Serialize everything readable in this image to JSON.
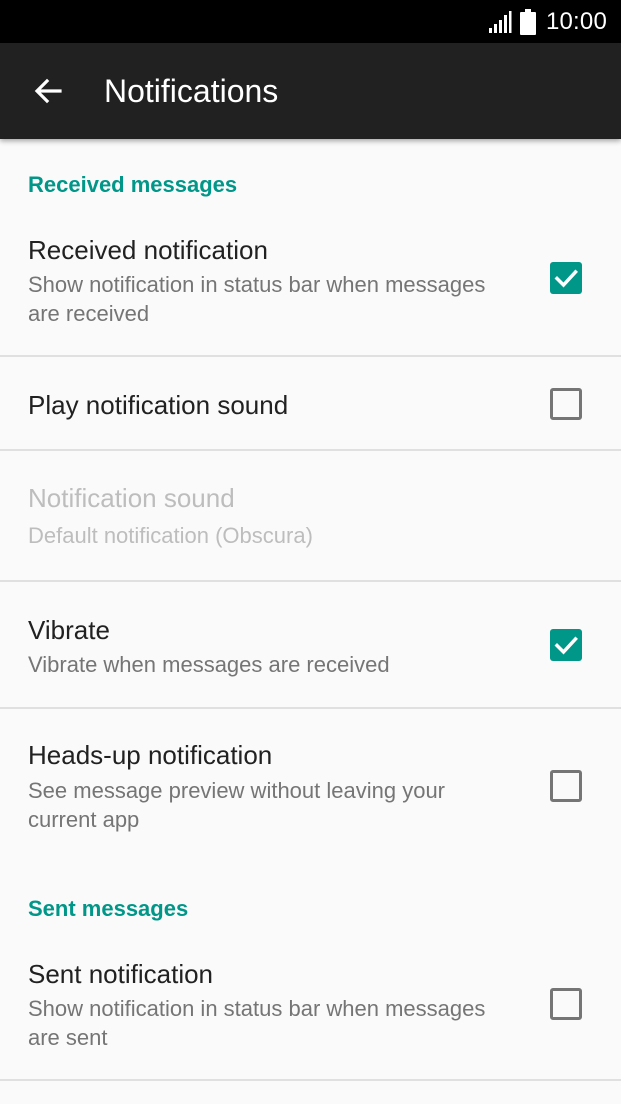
{
  "status_bar": {
    "time": "10:00",
    "signal_icon": "signal-icon",
    "battery_icon": "battery-icon"
  },
  "app_bar": {
    "back_icon": "arrow-back-icon",
    "title": "Notifications"
  },
  "colors": {
    "accent": "#009688",
    "app_bar": "#212121",
    "status_bar": "#000000",
    "background": "#fafafa",
    "primary_text": "#212121",
    "secondary_text": "#757575",
    "disabled_text": "#bdbdbd",
    "divider": "#e0e0e0"
  },
  "sections": {
    "received": {
      "header": "Received messages",
      "items": [
        {
          "title": "Received notification",
          "summary": "Show notification in status bar when messages are received",
          "checked": true,
          "enabled": true
        },
        {
          "title": "Play notification sound",
          "summary": "",
          "checked": false,
          "enabled": true
        },
        {
          "title": "Notification sound",
          "summary": "Default notification (Obscura)",
          "enabled": false
        },
        {
          "title": "Vibrate",
          "summary": "Vibrate when messages are received",
          "checked": true,
          "enabled": true
        },
        {
          "title": "Heads-up notification",
          "summary": "See message preview without leaving your current app",
          "checked": false,
          "enabled": true
        }
      ]
    },
    "sent": {
      "header": "Sent messages",
      "items": [
        {
          "title": "Sent notification",
          "summary": "Show notification in status bar when messages are sent",
          "checked": false,
          "enabled": true
        }
      ]
    }
  }
}
